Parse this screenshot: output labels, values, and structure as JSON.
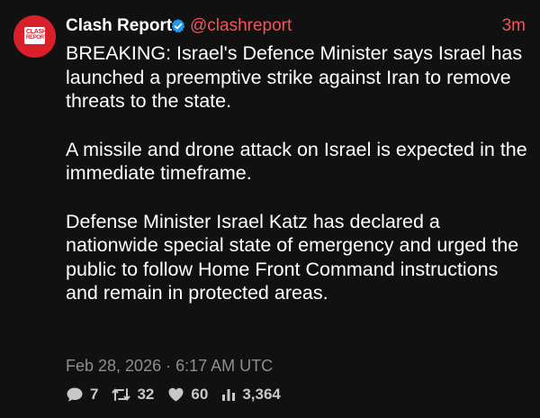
{
  "post": {
    "avatar": {
      "logo_line1": "CLASH",
      "logo_line2": "REPORT",
      "brand_color": "#d81f2a"
    },
    "author": {
      "name": "Clash Report",
      "handle": "@clashreport",
      "verified": true,
      "verified_icon": "verified-badge-icon",
      "handle_color": "#f2545b"
    },
    "time_ago": "3m",
    "paragraphs": [
      "BREAKING: Israel's Defence Minister says Israel has launched a preemptive strike against Iran to remove threats to the state.",
      "A missile and drone attack on Israel is expected in the immediate timeframe.",
      "Defense Minister Israel Katz has declared a nationwide special state of emergency and urged the public to follow Home Front Command instructions and remain in protected areas."
    ],
    "timestamp": "Feb 28, 2026 · 6:17 AM UTC",
    "stats": {
      "replies": "7",
      "reposts": "32",
      "likes": "60",
      "views": "3,364"
    },
    "icons": {
      "replies": "comment-icon",
      "reposts": "repost-icon",
      "likes": "heart-icon",
      "views": "views-icon"
    }
  }
}
